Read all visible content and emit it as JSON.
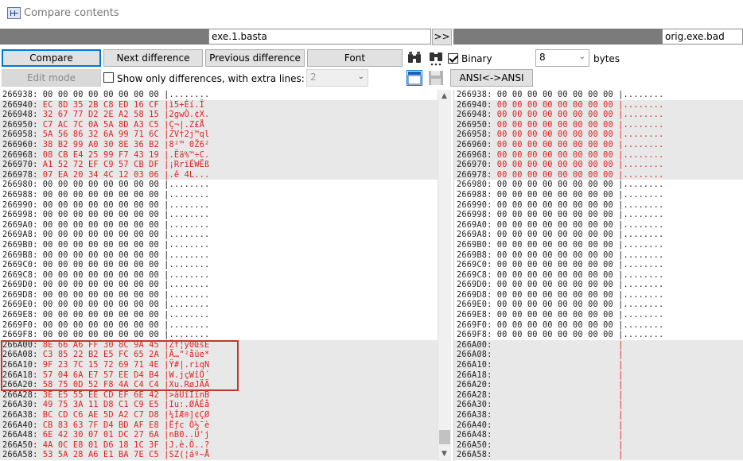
{
  "window": {
    "title": "Compare contents"
  },
  "files": {
    "left": "exe.1.basta",
    "right": "orig.exe.bad",
    "swap_label": ">>"
  },
  "toolbar": {
    "compare": "Compare",
    "next_difference": "Next difference",
    "previous_difference": "Previous difference",
    "font": "Font",
    "binary_label": "Binary",
    "binary_checked": true,
    "bytes_value": "8",
    "bytes_label": "bytes",
    "edit_mode": "Edit mode",
    "show_only_diff_label": "Show only differences, with extra lines:",
    "show_only_diff_checked": false,
    "extra_lines_value": "2",
    "ansi_label": "ANSI<->ANSI"
  },
  "colors": {
    "difference_text": "#e02020",
    "difference_bg": "#e8e8e8",
    "highlight_box": "#c0392b"
  },
  "left_rows": [
    {
      "text": "266938: 00 00 00 00 00 00 00 00 |........",
      "diff": false
    },
    {
      "text": "266940: EC 8D 35 2B C8 ED 16 CF |ì5+Èí.Ï",
      "diff": true
    },
    {
      "text": "266948: 32 67 77 D2 2E A2 58 15 |2gwÒ.¢X.",
      "diff": true
    },
    {
      "text": "266950: C7 AC 7C 0A 5A 8D A3 C5 |Ç¬|.Z£Å",
      "diff": true
    },
    {
      "text": "266958: 5A 56 86 32 6A 99 71 6C |ZV†2j™ql",
      "diff": true
    },
    {
      "text": "266960: 38 B2 99 A0 30 8E 36 B2 |8²™ 0Ž6²",
      "diff": true
    },
    {
      "text": "266968: 08 CB E4 25 99 F7 43 19 |.Ëä%™÷C.",
      "diff": true
    },
    {
      "text": "266970: A1 52 72 EF C9 57 CB DF |¡RrïÉWËß",
      "diff": true
    },
    {
      "text": "266978: 07 EA 20 34 4C 12 03 06 |.ê 4L...",
      "diff": true
    },
    {
      "text": "266980: 00 00 00 00 00 00 00 00 |........",
      "diff": false
    },
    {
      "text": "266988: 00 00 00 00 00 00 00 00 |........",
      "diff": false
    },
    {
      "text": "266990: 00 00 00 00 00 00 00 00 |........",
      "diff": false
    },
    {
      "text": "266998: 00 00 00 00 00 00 00 00 |........",
      "diff": false
    },
    {
      "text": "2669A0: 00 00 00 00 00 00 00 00 |........",
      "diff": false
    },
    {
      "text": "2669A8: 00 00 00 00 00 00 00 00 |........",
      "diff": false
    },
    {
      "text": "2669B0: 00 00 00 00 00 00 00 00 |........",
      "diff": false
    },
    {
      "text": "2669B8: 00 00 00 00 00 00 00 00 |........",
      "diff": false
    },
    {
      "text": "2669C0: 00 00 00 00 00 00 00 00 |........",
      "diff": false
    },
    {
      "text": "2669C8: 00 00 00 00 00 00 00 00 |........",
      "diff": false
    },
    {
      "text": "2669D0: 00 00 00 00 00 00 00 00 |........",
      "diff": false
    },
    {
      "text": "2669D8: 00 00 00 00 00 00 00 00 |........",
      "diff": false
    },
    {
      "text": "2669E0: 00 00 00 00 00 00 00 00 |........",
      "diff": false
    },
    {
      "text": "2669E8: 00 00 00 00 00 00 00 00 |........",
      "diff": false
    },
    {
      "text": "2669F0: 00 00 00 00 00 00 00 00 |........",
      "diff": false
    },
    {
      "text": "2669F8: 00 00 00 00 00 00 00 00 |........",
      "diff": false
    },
    {
      "text": "266A00: 8E 66 A6 FF 30 8C 9A 45 |Žf¦ÿ0ŒšE",
      "diff": true
    },
    {
      "text": "266A08: C3 85 22 B2 E5 FC 65 2A |Ã…\"²åüe*",
      "diff": true
    },
    {
      "text": "266A10: 9F 23 7C 15 72 69 71 4E |Ÿ#|.riqN",
      "diff": true
    },
    {
      "text": "266A18: 57 04 6A E7 57 EE D4 B4 |W.jçWîÔ´",
      "diff": true
    },
    {
      "text": "266A20: 58 75 0D 52 F8 4A C4 C4 |Xu.RøJÄÄ",
      "diff": true
    },
    {
      "text": "266A28: 3E E5 55 EE CD EF 6E 42 |>åUîÍïnB",
      "diff": true
    },
    {
      "text": "266A30: 49 75 3A 11 D8 C1 C9 E5 |Iu:.ØÁÉå",
      "diff": true
    },
    {
      "text": "266A38: BC CD C6 AE 5D A2 C7 D8 |¼ÍÆ®]¢ÇØ",
      "diff": true
    },
    {
      "text": "266A40: CB 83 63 7F D4 BD AF E8 |Ëƒc Ô½¯è",
      "diff": true
    },
    {
      "text": "266A48: 6E 42 30 07 01 DC 27 6A |nB0..Ü'j",
      "diff": true
    },
    {
      "text": "266A50: 4A 0C E8 01 D6 18 1C 3F |J.è.Ö..?",
      "diff": true
    },
    {
      "text": "266A58: 53 5A 28 A6 E1 BA 7E C5 |SZ(¦áº~Å",
      "diff": true
    }
  ],
  "right_rows": [
    {
      "text": "266938: 00 00 00 00 00 00 00 00 |........",
      "diff": false
    },
    {
      "text": "266940: 00 00 00 00 00 00 00 00 |........",
      "diff": true
    },
    {
      "text": "266948: 00 00 00 00 00 00 00 00 |........",
      "diff": true
    },
    {
      "text": "266950: 00 00 00 00 00 00 00 00 |........",
      "diff": true
    },
    {
      "text": "266958: 00 00 00 00 00 00 00 00 |........",
      "diff": true
    },
    {
      "text": "266960: 00 00 00 00 00 00 00 00 |........",
      "diff": true
    },
    {
      "text": "266968: 00 00 00 00 00 00 00 00 |........",
      "diff": true
    },
    {
      "text": "266970: 00 00 00 00 00 00 00 00 |........",
      "diff": true
    },
    {
      "text": "266978: 00 00 00 00 00 00 00 00 |........",
      "diff": true
    },
    {
      "text": "266980: 00 00 00 00 00 00 00 00 |........",
      "diff": false
    },
    {
      "text": "266988: 00 00 00 00 00 00 00 00 |........",
      "diff": false
    },
    {
      "text": "266990: 00 00 00 00 00 00 00 00 |........",
      "diff": false
    },
    {
      "text": "266998: 00 00 00 00 00 00 00 00 |........",
      "diff": false
    },
    {
      "text": "2669A0: 00 00 00 00 00 00 00 00 |........",
      "diff": false
    },
    {
      "text": "2669A8: 00 00 00 00 00 00 00 00 |........",
      "diff": false
    },
    {
      "text": "2669B0: 00 00 00 00 00 00 00 00 |........",
      "diff": false
    },
    {
      "text": "2669B8: 00 00 00 00 00 00 00 00 |........",
      "diff": false
    },
    {
      "text": "2669C0: 00 00 00 00 00 00 00 00 |........",
      "diff": false
    },
    {
      "text": "2669C8: 00 00 00 00 00 00 00 00 |........",
      "diff": false
    },
    {
      "text": "2669D0: 00 00 00 00 00 00 00 00 |........",
      "diff": false
    },
    {
      "text": "2669D8: 00 00 00 00 00 00 00 00 |........",
      "diff": false
    },
    {
      "text": "2669E0: 00 00 00 00 00 00 00 00 |........",
      "diff": false
    },
    {
      "text": "2669E8: 00 00 00 00 00 00 00 00 |........",
      "diff": false
    },
    {
      "text": "2669F0: 00 00 00 00 00 00 00 00 |........",
      "diff": false
    },
    {
      "text": "2669F8: 00 00 00 00 00 00 00 00 |........",
      "diff": false
    },
    {
      "text": "266A00:                         |",
      "diff": true
    },
    {
      "text": "266A08:                         |",
      "diff": true
    },
    {
      "text": "266A10:                         |",
      "diff": true
    },
    {
      "text": "266A18:                         |",
      "diff": true
    },
    {
      "text": "266A20:                         |",
      "diff": true
    },
    {
      "text": "266A28:                         |",
      "diff": true
    },
    {
      "text": "266A30:                         |",
      "diff": true
    },
    {
      "text": "266A38:                         |",
      "diff": true
    },
    {
      "text": "266A40:                         |",
      "diff": true
    },
    {
      "text": "266A48:                         |",
      "diff": true
    },
    {
      "text": "266A50:                         |",
      "diff": true
    },
    {
      "text": "266A58:                         |",
      "diff": true
    }
  ]
}
